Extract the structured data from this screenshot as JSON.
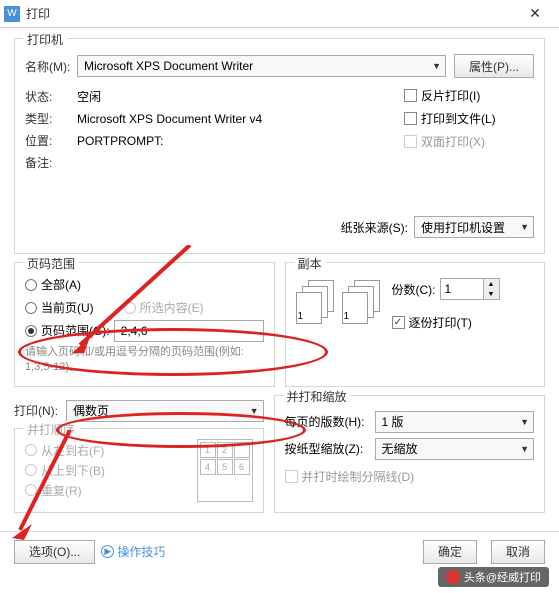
{
  "titlebar": {
    "title": "打印"
  },
  "printer": {
    "group": "打印机",
    "name_lbl": "名称(M):",
    "name_val": "Microsoft XPS Document Writer",
    "properties_btn": "属性(P)...",
    "status_lbl": "状态:",
    "status_val": "空闲",
    "type_lbl": "类型:",
    "type_val": "Microsoft XPS Document Writer v4",
    "loc_lbl": "位置:",
    "loc_val": "PORTPROMPT:",
    "note_lbl": "备注:",
    "reverse": "反片打印(I)",
    "tofile": "打印到文件(L)",
    "duplex": "双面打印(X)",
    "paper_src_lbl": "纸张来源(S):",
    "paper_src_val": "使用打印机设置"
  },
  "range": {
    "group": "页码范围",
    "all": "全部(A)",
    "current": "当前页(U)",
    "selection": "所选内容(E)",
    "pages": "页码范围(G):",
    "pages_val": "2,4,6",
    "hint": "请输入页码和/或用逗号分隔的页码范围(例如: 1,3,5-12)。",
    "print_lbl": "打印(N):",
    "print_val": "偶数页",
    "order_group": "并打顺序",
    "lr": "从左到右(F)",
    "tb": "从上到下(B)",
    "repeat": "重复(R)"
  },
  "copies": {
    "group": "副本",
    "count_lbl": "份数(C):",
    "count_val": "1",
    "collate": "逐份打印(T)"
  },
  "scale": {
    "group": "并打和缩放",
    "perpage_lbl": "每页的版数(H):",
    "perpage_val": "1 版",
    "bysize_lbl": "按纸型缩放(Z):",
    "bysize_val": "无缩放",
    "gridlines": "并打时绘制分隔线(D)"
  },
  "bottom": {
    "options": "选项(O)...",
    "tips": "操作技巧",
    "ok": "确定",
    "cancel": "取消"
  },
  "watermark": "头条@经威打印"
}
